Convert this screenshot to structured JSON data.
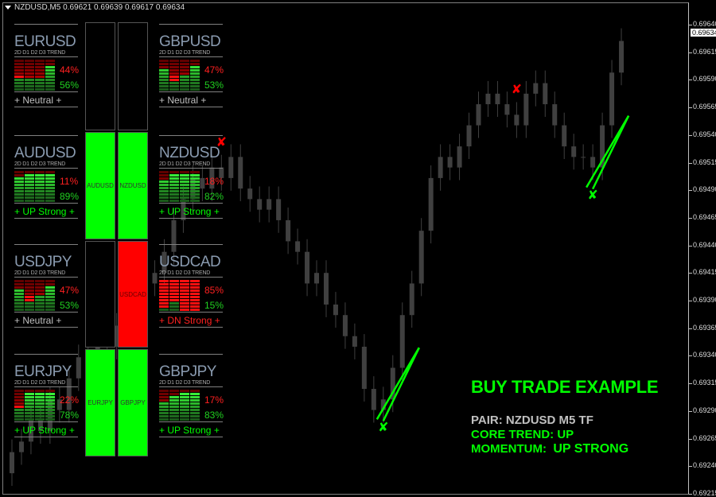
{
  "window": {
    "title": "NZDUSD,M5  0.69621 0.69639 0.69617 0.69634",
    "current_price": "0.69634"
  },
  "price_axis": [
    "0.69640",
    "0.69615",
    "0.69590",
    "0.69565",
    "0.69540",
    "0.69515",
    "0.69490",
    "0.69465",
    "0.69440",
    "0.69415",
    "0.69390",
    "0.69365",
    "0.69340",
    "0.69315",
    "0.69290",
    "0.69265",
    "0.69240",
    "0.69215"
  ],
  "panels": [
    {
      "symbol": "EURUSD",
      "header": "2D D1 D2 D3 TREND",
      "bear_pct": "44%",
      "bull_pct": "56%",
      "status": "+   Neutral   +",
      "status_color": "#c0c0c0",
      "cols": [
        [
          0,
          0,
          0,
          0,
          0,
          -1,
          1,
          1,
          1,
          1
        ],
        [
          0,
          0,
          0,
          0,
          0,
          0,
          1,
          1,
          1,
          1
        ],
        [
          0,
          0,
          0,
          0,
          0,
          0,
          1,
          1,
          1,
          1
        ],
        [
          0,
          0,
          1,
          1,
          1,
          1,
          1,
          1,
          1,
          1
        ]
      ],
      "bull_fraction": 0.56
    },
    {
      "symbol": "GBPUSD",
      "header": "2D D1 D2 D3 TREND",
      "bear_pct": "47%",
      "bull_pct": "53%",
      "status": "+   Neutral   +",
      "status_color": "#c0c0c0",
      "cols": [
        [
          0,
          0,
          0,
          1,
          1,
          1,
          1,
          1,
          1,
          1
        ],
        [
          0,
          0,
          0,
          0,
          0,
          -1,
          -1,
          1,
          1,
          1
        ],
        [
          0,
          0,
          0,
          0,
          0,
          1,
          1,
          1,
          1,
          1
        ],
        [
          0,
          0,
          1,
          1,
          1,
          1,
          1,
          1,
          1,
          1
        ]
      ],
      "bull_fraction": 0.53
    },
    {
      "symbol": "AUDUSD",
      "header": "2D D1 D2 D3 TREND",
      "bear_pct": "11%",
      "bull_pct": "89%",
      "status": "+ UP Strong +",
      "status_color": "#00ff00",
      "cols": [
        [
          0,
          0,
          1,
          1,
          1,
          1,
          1,
          1,
          1,
          1
        ],
        [
          0,
          1,
          1,
          1,
          1,
          1,
          1,
          1,
          1,
          1
        ],
        [
          0,
          1,
          1,
          1,
          1,
          1,
          1,
          1,
          1,
          1
        ],
        [
          0,
          1,
          1,
          1,
          1,
          1,
          1,
          1,
          1,
          1
        ]
      ],
      "bull_fraction": 0.89
    },
    {
      "symbol": "NZDUSD",
      "header": "2D D1 D2 D3 TREND",
      "bear_pct": "18%",
      "bull_pct": "82%",
      "status": "+ UP Strong +",
      "status_color": "#00ff00",
      "cols": [
        [
          0,
          0,
          0,
          1,
          1,
          1,
          1,
          1,
          1,
          1
        ],
        [
          0,
          1,
          1,
          1,
          1,
          1,
          1,
          1,
          1,
          1
        ],
        [
          0,
          1,
          1,
          1,
          1,
          1,
          1,
          1,
          1,
          1
        ],
        [
          0,
          1,
          1,
          1,
          1,
          1,
          1,
          1,
          1,
          1
        ]
      ],
      "bull_fraction": 0.82
    },
    {
      "symbol": "USDJPY",
      "header": "2D D1 D2 D3 TREND",
      "bear_pct": "47%",
      "bull_pct": "53%",
      "status": "+   Neutral   +",
      "status_color": "#c0c0c0",
      "cols": [
        [
          0,
          0,
          0,
          1,
          1,
          1,
          1,
          1,
          1,
          1
        ],
        [
          0,
          0,
          0,
          0,
          0,
          -1,
          -1,
          1,
          1,
          1
        ],
        [
          0,
          0,
          0,
          0,
          0,
          1,
          1,
          1,
          1,
          1
        ],
        [
          0,
          0,
          1,
          1,
          1,
          1,
          1,
          1,
          1,
          1
        ]
      ],
      "bull_fraction": 0.53
    },
    {
      "symbol": "USDCAD",
      "header": "2D D1 D2 D3 TREND",
      "bear_pct": "85%",
      "bull_pct": "15%",
      "status": "+ DN Strong +",
      "status_color": "#ff2020",
      "cols": [
        [
          -1,
          -1,
          -1,
          -1,
          -1,
          -1,
          -1,
          -1,
          -1,
          1
        ],
        [
          -1,
          -1,
          -1,
          -1,
          -1,
          -1,
          -1,
          1,
          1,
          1
        ],
        [
          -1,
          -1,
          -1,
          -1,
          -1,
          -1,
          -1,
          -1,
          -1,
          -1
        ],
        [
          -1,
          -1,
          -1,
          -1,
          -1,
          -1,
          -1,
          -1,
          -1,
          -1
        ]
      ],
      "bull_fraction": 0.15
    },
    {
      "symbol": "EURJPY",
      "header": "2D D1 D2 D3 TREND",
      "bear_pct": "22%",
      "bull_pct": "78%",
      "status": "+ UP Strong +",
      "status_color": "#00ff00",
      "cols": [
        [
          0,
          0,
          0,
          0,
          0,
          -1,
          1,
          1,
          1,
          1
        ],
        [
          0,
          1,
          1,
          1,
          1,
          1,
          1,
          1,
          1,
          1
        ],
        [
          0,
          1,
          1,
          1,
          1,
          1,
          1,
          1,
          1,
          1
        ],
        [
          0,
          1,
          1,
          1,
          1,
          1,
          1,
          1,
          1,
          1
        ]
      ],
      "bull_fraction": 0.78
    },
    {
      "symbol": "GBPJPY",
      "header": "2D D1 D2 D3 TREND",
      "bear_pct": "17%",
      "bull_pct": "83%",
      "status": "+ UP Strong +",
      "status_color": "#00ff00",
      "cols": [
        [
          0,
          0,
          0,
          0,
          1,
          1,
          1,
          1,
          1,
          1
        ],
        [
          0,
          0,
          1,
          1,
          1,
          1,
          1,
          1,
          1,
          1
        ],
        [
          0,
          1,
          1,
          1,
          1,
          1,
          1,
          1,
          1,
          1
        ],
        [
          0,
          1,
          1,
          1,
          1,
          1,
          1,
          1,
          1,
          1
        ]
      ],
      "bull_fraction": 0.83
    }
  ],
  "signal_boxes": [
    {
      "label": "",
      "state": "empty"
    },
    {
      "label": "",
      "state": "empty"
    },
    {
      "label": "AUDUSD",
      "state": "green"
    },
    {
      "label": "NZDUSD",
      "state": "green"
    },
    {
      "label": "",
      "state": "empty"
    },
    {
      "label": "USDCAD",
      "state": "red"
    },
    {
      "label": "EURJPY",
      "state": "green"
    },
    {
      "label": "GBPJPY",
      "state": "green"
    }
  ],
  "buy_example": {
    "heading": "BUY TRADE EXAMPLE",
    "pair": "PAIR: NZDUSD M5 TF",
    "core_trend": "CORE TREND: UP",
    "momentum_label": "MOMENTUM:",
    "momentum_value": "UP STRONG"
  },
  "colors": {
    "bull": "#00ff00",
    "bear": "#ff0000",
    "candle": "#404040",
    "text_gray": "#c0c0c0"
  },
  "chart_data": {
    "type": "candlestick",
    "symbol": "NZDUSD",
    "timeframe": "M5",
    "ylim": [
      0.69205,
      0.6965
    ],
    "close": [
      0.6924,
      0.6925,
      0.6927,
      0.6926,
      0.6929,
      0.6928,
      0.6931,
      0.6933,
      0.6932,
      0.6935,
      0.6934,
      0.6936,
      0.6938,
      0.6937,
      0.694,
      0.6941,
      0.6943,
      0.6946,
      0.6948,
      0.695,
      0.6949,
      0.6951,
      0.695,
      0.6952,
      0.6949,
      0.6948,
      0.6947,
      0.6948,
      0.6946,
      0.6944,
      0.6943,
      0.694,
      0.6941,
      0.6938,
      0.6937,
      0.6935,
      0.6934,
      0.693,
      0.6928,
      0.6929,
      0.6932,
      0.6937,
      0.694,
      0.6945,
      0.695,
      0.6952,
      0.6951,
      0.6953,
      0.6955,
      0.6957,
      0.6958,
      0.6957,
      0.6956,
      0.6955,
      0.6958,
      0.6959,
      0.6957,
      0.6955,
      0.6953,
      0.6952,
      0.6952,
      0.6951,
      0.6955,
      0.696,
      0.6963
    ],
    "signals": [
      {
        "type": "sell",
        "index": 22
      },
      {
        "type": "buy",
        "index": 39
      },
      {
        "type": "sell",
        "index": 53
      },
      {
        "type": "buy",
        "index": 61
      }
    ]
  }
}
